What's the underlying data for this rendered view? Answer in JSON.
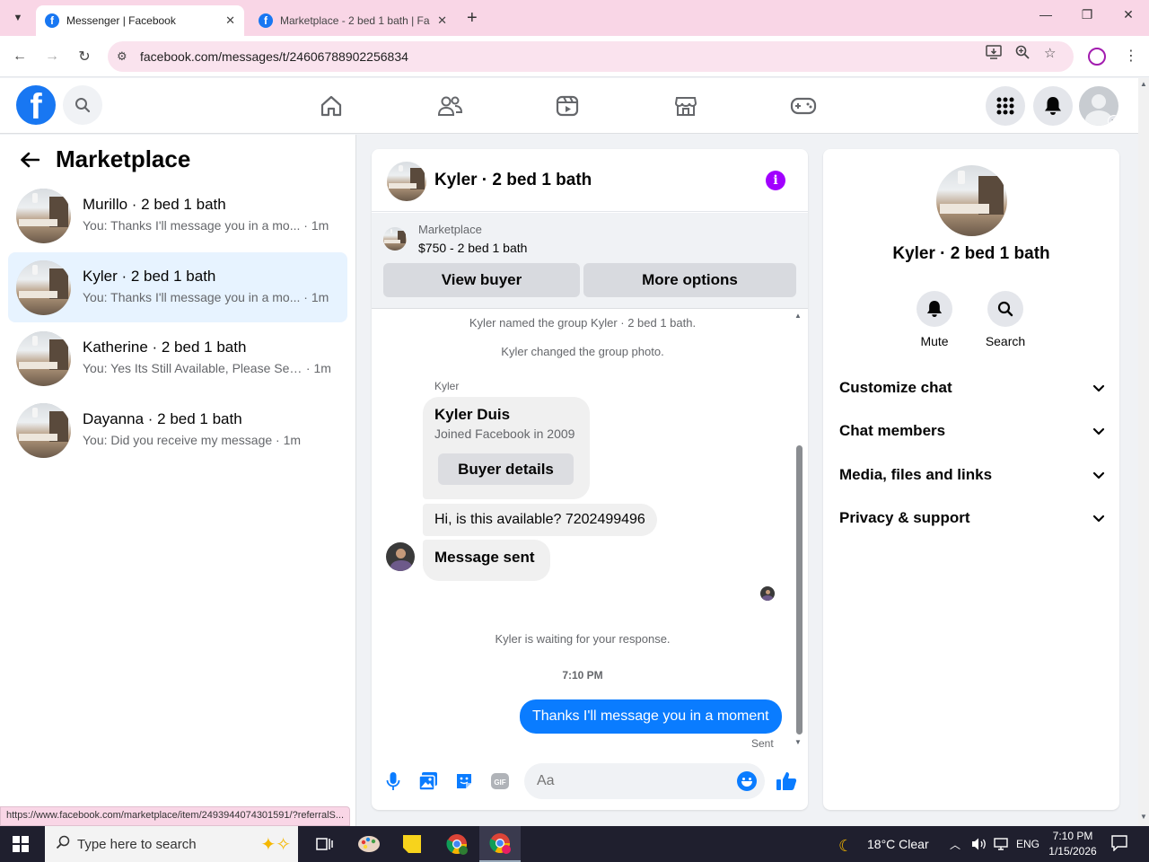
{
  "browser": {
    "tabs": [
      {
        "title": "Messenger | Facebook",
        "active": true
      },
      {
        "title": "Marketplace - 2 bed 1 bath | Fa",
        "active": false
      }
    ],
    "url": "facebook.com/messages/t/24606788902256834",
    "status_url": "https://www.facebook.com/marketplace/item/2493944074301591/?referralS..."
  },
  "colors": {
    "brand": "#1877f2",
    "outgoing_bubble": "#0a7cff",
    "info_button": "#a100ff",
    "selected_row": "#e7f3ff"
  },
  "left_panel": {
    "title": "Marketplace",
    "conversations": [
      {
        "name": "Murillo · 2 bed 1 bath",
        "preview": "You: Thanks I'll message you in a mo...",
        "time": "· 1m",
        "selected": false
      },
      {
        "name": "Kyler · 2 bed 1 bath",
        "preview": "You: Thanks I'll message you in a mo...",
        "time": "· 1m",
        "selected": true
      },
      {
        "name": "Katherine · 2 bed 1 bath",
        "preview": "You: Yes Its Still Available, Please Sen...",
        "time": "· 1m",
        "selected": false
      },
      {
        "name": "Dayanna · 2 bed 1 bath",
        "preview": "You: Did you receive my message",
        "time": "· 1m",
        "selected": false
      }
    ]
  },
  "chat": {
    "title": "Kyler · 2 bed 1 bath",
    "marketplace_label": "Marketplace",
    "listing": "$750 - 2 bed 1 bath",
    "view_buyer": "View buyer",
    "more_options": "More options",
    "system_1": "Kyler named the group Kyler · 2 bed 1 bath.",
    "system_2": "Kyler changed the group photo.",
    "sender": "Kyler",
    "card_name": "Kyler Duis",
    "card_joined": "Joined Facebook in 2009",
    "card_button": "Buyer details",
    "incoming_1": "Hi, is this available? 7202499496",
    "incoming_2": "Message sent",
    "waiting": "Kyler is waiting for your response.",
    "timestamp": "7:10 PM",
    "outgoing_1": "Thanks I'll message you in a moment",
    "sent_label": "Sent",
    "composer_placeholder": "Aa"
  },
  "right_panel": {
    "title": "Kyler · 2 bed 1 bath",
    "mute": "Mute",
    "search": "Search",
    "sections": [
      "Customize chat",
      "Chat members",
      "Media, files and links",
      "Privacy & support"
    ]
  },
  "taskbar": {
    "search_placeholder": "Type here to search",
    "weather": "18°C  Clear",
    "lang": "ENG",
    "time": "7:10 PM",
    "date": "1/15/2026"
  }
}
